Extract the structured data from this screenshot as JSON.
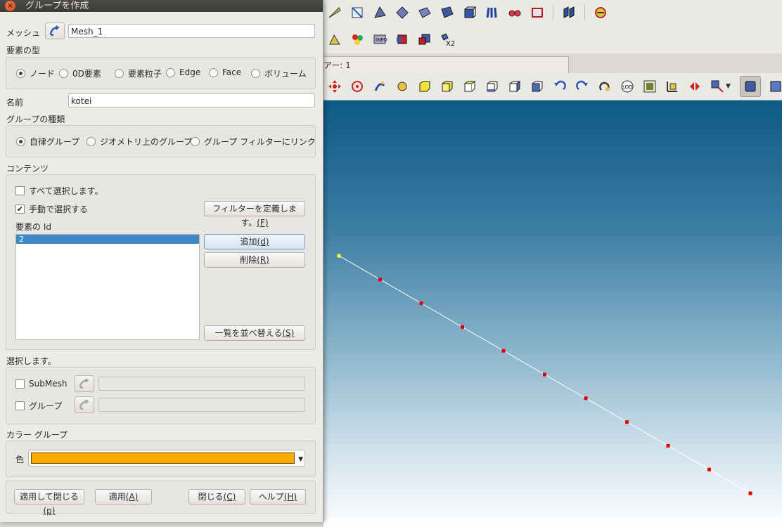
{
  "dialog": {
    "title": "グループを作成",
    "mesh_label": "メッシュ",
    "mesh_value": "Mesh_1",
    "element_type_label": "要素の型",
    "element_types": [
      {
        "label": "ノード",
        "checked": true
      },
      {
        "label": "0D要素",
        "checked": false
      },
      {
        "label": "要素粒子",
        "checked": false
      },
      {
        "label": "Edge",
        "checked": false
      },
      {
        "label": "Face",
        "checked": false
      },
      {
        "label": "ボリューム",
        "checked": false
      }
    ],
    "name_label": "名前",
    "name_value": "kotei",
    "group_type_label": "グループの種類",
    "group_types": [
      {
        "label": "自律グループ",
        "checked": true
      },
      {
        "label": "ジオメトリ上のグループ",
        "checked": false
      },
      {
        "label": "グループ フィルターにリンク",
        "checked": false
      }
    ],
    "contents_label": "コンテンツ",
    "select_all_label": "すべて選択します。",
    "manual_select_label": "手動で選択する",
    "define_filter_label": "フィルターを定義します。",
    "define_filter_key": "(F)",
    "element_ids_label": "要素の Id",
    "element_ids": [
      "2"
    ],
    "add_label": "追加",
    "add_key": "(d)",
    "remove_label": "削除",
    "remove_key": "(R)",
    "sort_label": "一覧を並べ替える",
    "sort_key": "(S)",
    "select_label": "選択します。",
    "submesh_label": "SubMesh",
    "group_label": "グループ",
    "color_group_label": "カラー グループ",
    "color_label": "色",
    "color_value": "#ffaa00",
    "apply_close_label": "適用して閉じる",
    "apply_close_key": "(p)",
    "apply_label": "適用",
    "apply_key": "(A)",
    "close_label": "閉じる",
    "close_key": "(C)",
    "help_label": "ヘルプ",
    "help_key": "(H)"
  },
  "app": {
    "view_tab_label": "アー: 1",
    "toolbar_badge": "X2"
  },
  "colors": {
    "node": "#e00000",
    "selected_node": "#ffff30",
    "edge": "#ffffff"
  }
}
